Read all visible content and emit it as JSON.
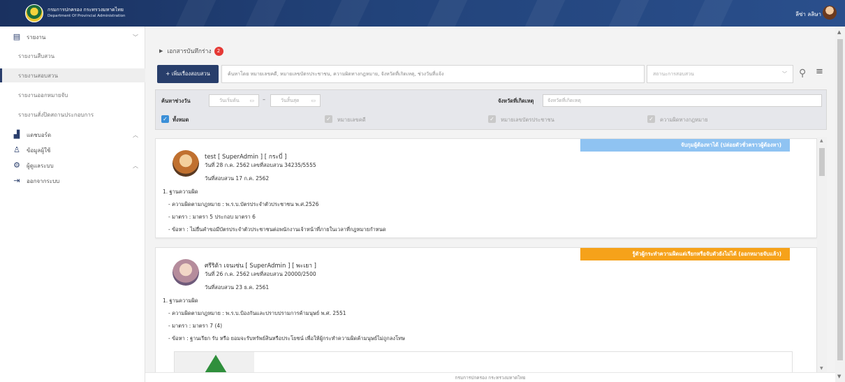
{
  "header": {
    "org_title": "กรมการปกครอง กระทรวงมหาดไทย",
    "org_subtitle": "Department Of Provincial Administration",
    "user_name": "ลีซ่า ลลิษา"
  },
  "sidebar": {
    "groups": [
      {
        "label": "รายงาน",
        "icon": "report-icon"
      },
      {
        "label": "แดชบอร์ด",
        "icon": "chart-icon"
      },
      {
        "label": "ข้อมูลผู้ใช้",
        "icon": "user-icon"
      },
      {
        "label": "ผู้ดูแลระบบ",
        "icon": "gear-icon"
      },
      {
        "label": "ออกจากระบบ",
        "icon": "logout-icon"
      }
    ],
    "report_items": [
      {
        "label": "รายงานสืบสวน"
      },
      {
        "label": "รายงานสอบสวน"
      },
      {
        "label": "รายงานออกหมายจับ"
      },
      {
        "label": "รายงานสั่งปิดสถานประกอบการ"
      }
    ]
  },
  "main": {
    "drafts_label": "เอกสารบันทึกร่าง",
    "drafts_count": "2",
    "add_button": "+ เพิ่มเรื่องสอบสวน",
    "search_placeholder": "ค้นหาโดย หมายเลขคดี, หมายเลขบัตรประชาชน, ความผิดทางกฎหมาย, จังหวัดที่เกิดเหตุ, ช่วงวันที่แจ้ง",
    "status_placeholder": "สถานะการสอบสวน",
    "filter": {
      "date_range_label": "ค้นหาช่วงวัน",
      "start_date_placeholder": "วันเริ่มต้น",
      "end_date_placeholder": "วันสิ้นสุด",
      "province_label": "จังหวัดที่เกิดเหตุ",
      "province_placeholder": "จังหวัดที่เกิดเหตุ",
      "checkboxes": [
        {
          "label": "ทั้งหมด",
          "checked": true
        },
        {
          "label": "หมายเลขคดี",
          "checked": false
        },
        {
          "label": "หมายเลขบัตรประชาชน",
          "checked": false
        },
        {
          "label": "ความผิดทางกฎหมาย",
          "checked": false
        }
      ]
    },
    "cards": [
      {
        "tag": "จับกุมผู้ต้องหาได้ (ปล่อยตัวชั่วคราวผู้ต้องหา)",
        "tag_color": "#8fc3f2",
        "name": "test [ SuperAdmin ] [ กระบี่ ]",
        "date_line": "วันที่ 28 ก.ค. 2562 เลขที่สอบสวน 34235/5555",
        "inquiry_date": "วันที่สอบสวน 17 ก.ค. 2562",
        "section_title": "1. ฐานความผิด",
        "law": "- ความผิดตามกฎหมาย : พ.ร.บ.บัตรประจำตัวประชาชน พ.ศ.2526",
        "article": "- มาตรา : มาตรา 5 ประกอบ มาตรา 6",
        "charge": "- ข้อหา : ไม่ยื่นคำขอมีบัตรประจำตัวประชาชนต่อพนักงานเจ้าหน้าที่ภายในเวลาที่กฎหมายกำหนด"
      },
      {
        "tag": "รู้ตัวผู้กระทำความผิดแต่เรียกหรือจับตัวยังไม่ได้ (ออกหมายจับแล้ว)",
        "tag_color": "#f6a21a",
        "name": "ศรีริต้า เจนเซ่น [ SuperAdmin ] [ พะเยา ]",
        "date_line": "วันที่ 26 ก.ค. 2562 เลขที่สอบสวน 20000/2500",
        "inquiry_date": "วันที่สอบสวน 23 ธ.ค. 2561",
        "section_title": "1. ฐานความผิด",
        "law": "- ความผิดตามกฎหมาย : พ.ร.บ.ป้องกันและปราบปรามการค้ามนุษย์ พ.ศ. 2551",
        "article": "- มาตรา : มาตรา 7 (4)",
        "charge": "- ข้อหา : ฐานเรียก รับ หรือ ยอมจะรับทรัพย์สินหรือประโยชน์ เพื่อให้ผู้กระทำความผิดค้ามนุษย์ไม่ถูกลงโทษ"
      }
    ]
  },
  "footer": {
    "text": "กรมการปกครอง กระทรวงมหาดไทย"
  }
}
